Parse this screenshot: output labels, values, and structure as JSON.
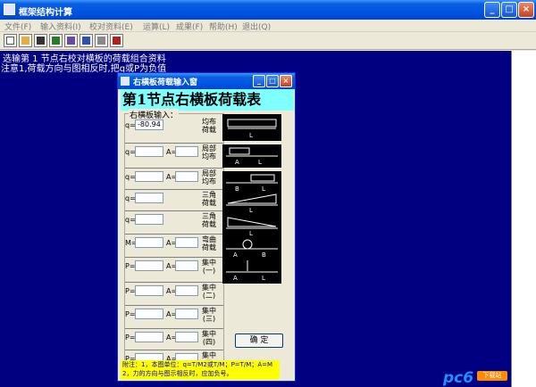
{
  "window": {
    "title": "框架结构计算"
  },
  "menu": [
    "文件(F)",
    "输入资料(I)",
    "校对资料(E)",
    "运算(L)",
    "成果(F)",
    "帮助(H)",
    "退出(Q)"
  ],
  "toolbar_icons": [
    "new-file-icon",
    "open-folder-icon",
    "save-icon",
    "arrow-icon",
    "structure-icon",
    "grid-icon",
    "print-icon",
    "book-icon"
  ],
  "workarea": {
    "line1": " 选输第 1 节点右校对横板的荷载组合资料",
    "line2": "注意1,荷载方向与图相反时,把q或P为负值"
  },
  "dialog": {
    "title": "右横板荷载输入窗",
    "banner": "第1节点右横板荷载表",
    "group_label": "右横板输入：",
    "rows": [
      {
        "field1_label": "q=",
        "field1_value": "-80.94",
        "has_a": false,
        "a_label": "",
        "right_label": "均布\n荷载"
      },
      {
        "field1_label": "q=",
        "field1_value": "",
        "has_a": true,
        "a_label": "A=",
        "right_label": "局部\n均布"
      },
      {
        "field1_label": "q=",
        "field1_value": "",
        "has_a": true,
        "a_label": "A=",
        "right_label": "局部\n均布"
      },
      {
        "field1_label": "q=",
        "field1_value": "",
        "has_a": false,
        "a_label": "",
        "right_label": "三角\n荷载"
      },
      {
        "field1_label": "q=",
        "field1_value": "",
        "has_a": false,
        "a_label": "",
        "right_label": "三角\n荷载"
      },
      {
        "field1_label": "M=",
        "field1_value": "",
        "has_a": true,
        "a_label": "A=",
        "right_label": "弯曲\n荷载"
      },
      {
        "field1_label": "P=",
        "field1_value": "",
        "has_a": true,
        "a_label": "A=",
        "right_label": "集中\n(一)"
      },
      {
        "field1_label": "P=",
        "field1_value": "",
        "has_a": true,
        "a_label": "A=",
        "right_label": "集中\n(二)"
      },
      {
        "field1_label": "P=",
        "field1_value": "",
        "has_a": true,
        "a_label": "A=",
        "right_label": "集中\n(三)"
      },
      {
        "field1_label": "P=",
        "field1_value": "",
        "has_a": true,
        "a_label": "A=",
        "right_label": "集中\n(四)"
      },
      {
        "field1_label": "P=",
        "field1_value": "",
        "has_a": true,
        "a_label": "A=",
        "right_label": "集中\n(五)"
      }
    ],
    "ok_label": "确 定",
    "note_line1": "附注：1，本图单位：q=T/M2或T/M；P=T/M；A=M",
    "note_line2": "      2，力的方向与图示相反时，应加负号。"
  },
  "watermark": {
    "brand": "pc6",
    "badge": "下载站"
  },
  "colors": {
    "workarea": "#000080",
    "banner": "#80ffff",
    "note": "#ffff00",
    "titlebar": "#0054e3"
  }
}
